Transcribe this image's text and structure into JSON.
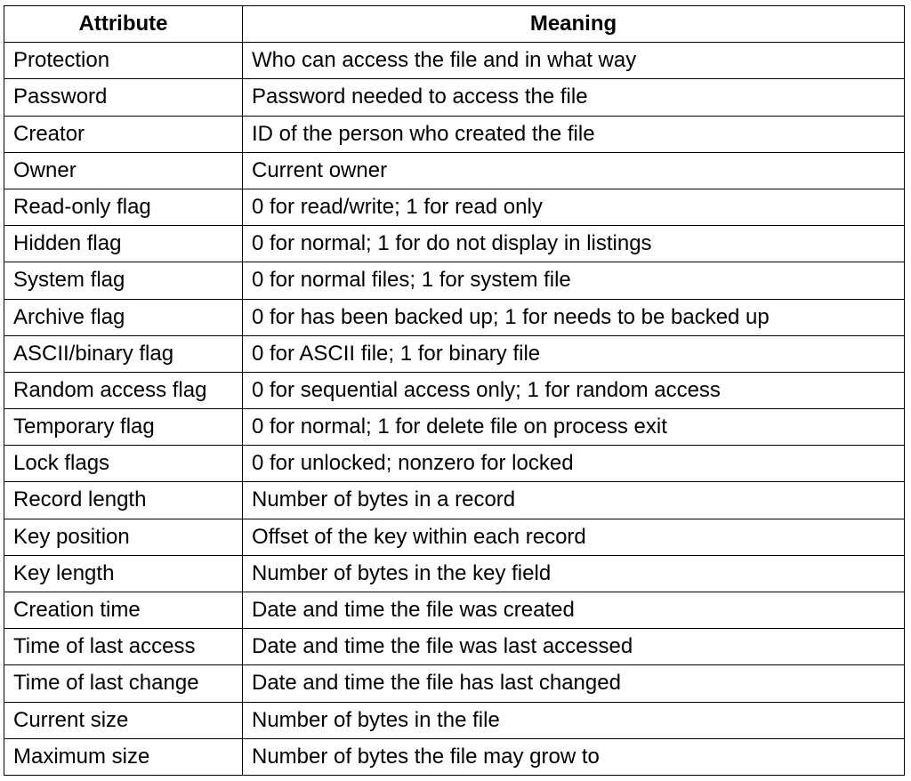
{
  "table": {
    "headers": {
      "attribute": "Attribute",
      "meaning": "Meaning"
    },
    "rows": [
      {
        "attribute": "Protection",
        "meaning": "Who can access the file and in what way"
      },
      {
        "attribute": "Password",
        "meaning": "Password needed to access the file"
      },
      {
        "attribute": "Creator",
        "meaning": "ID of the person who created the file"
      },
      {
        "attribute": "Owner",
        "meaning": "Current owner"
      },
      {
        "attribute": "Read-only flag",
        "meaning": "0 for read/write; 1 for read only"
      },
      {
        "attribute": "Hidden flag",
        "meaning": "0 for normal; 1 for do not display in listings"
      },
      {
        "attribute": "System flag",
        "meaning": "0 for normal files; 1 for system file"
      },
      {
        "attribute": "Archive flag",
        "meaning": "0 for has been backed up; 1 for needs to be backed up"
      },
      {
        "attribute": "ASCII/binary flag",
        "meaning": "0 for ASCII file; 1 for binary file"
      },
      {
        "attribute": "Random access flag",
        "meaning": "0 for sequential access only; 1 for random access"
      },
      {
        "attribute": "Temporary flag",
        "meaning": "0 for normal; 1 for delete file on process exit"
      },
      {
        "attribute": "Lock flags",
        "meaning": "0 for unlocked; nonzero for locked"
      },
      {
        "attribute": "Record length",
        "meaning": "Number of bytes in a record"
      },
      {
        "attribute": "Key position",
        "meaning": "Offset of the key within each record"
      },
      {
        "attribute": "Key length",
        "meaning": "Number of bytes in the key field"
      },
      {
        "attribute": "Creation time",
        "meaning": "Date and time the file was created"
      },
      {
        "attribute": "Time of last access",
        "meaning": "Date and time the file was last accessed"
      },
      {
        "attribute": "Time of last change",
        "meaning": "Date and time the file has last changed"
      },
      {
        "attribute": "Current size",
        "meaning": "Number of bytes in the file"
      },
      {
        "attribute": "Maximum size",
        "meaning": "Number of bytes the file may grow to"
      }
    ]
  }
}
